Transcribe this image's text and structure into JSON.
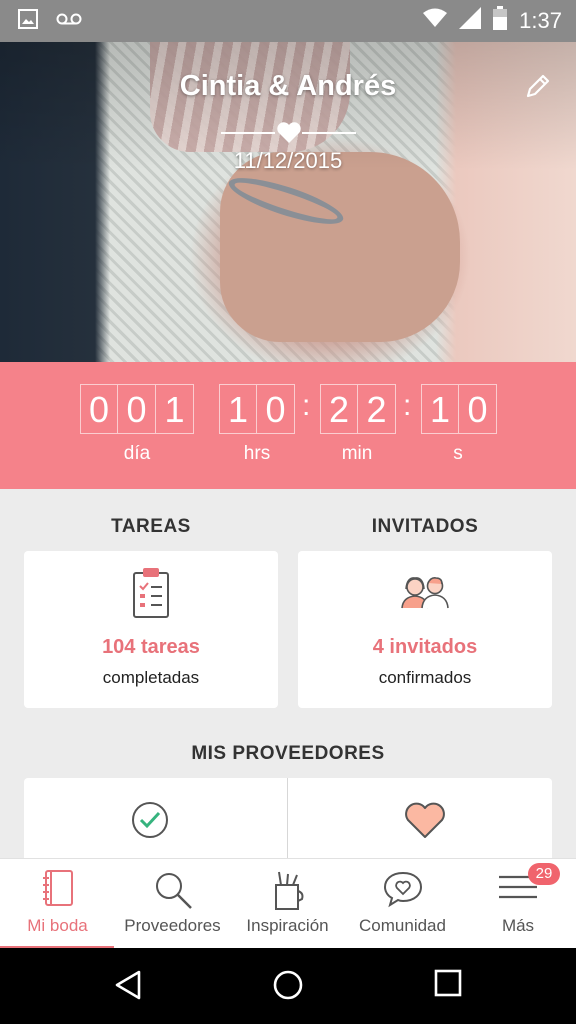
{
  "status_bar": {
    "time": "1:37",
    "icons": [
      "image-icon",
      "voicemail-icon",
      "wifi-icon",
      "signal-icon",
      "battery-icon"
    ]
  },
  "hero": {
    "couple_names": "Cintia & Andrés",
    "date": "11/12/2015"
  },
  "countdown": {
    "days": [
      "0",
      "0",
      "1"
    ],
    "hours": [
      "1",
      "0"
    ],
    "minutes": [
      "2",
      "2"
    ],
    "seconds": [
      "1",
      "0"
    ],
    "labels": {
      "days": "día",
      "hours": "hrs",
      "minutes": "min",
      "seconds": "s"
    }
  },
  "tasks": {
    "title": "TAREAS",
    "count": "104 tareas",
    "sub": "completadas"
  },
  "guests": {
    "title": "INVITADOS",
    "count": "4 invitados",
    "sub": "confirmados"
  },
  "providers": {
    "title": "MIS PROVEEDORES"
  },
  "bottom_nav": {
    "items": [
      {
        "label": "Mi boda",
        "icon": "notebook-icon"
      },
      {
        "label": "Proveedores",
        "icon": "search-icon"
      },
      {
        "label": "Inspiración",
        "icon": "inspiration-icon"
      },
      {
        "label": "Comunidad",
        "icon": "chat-heart-icon"
      },
      {
        "label": "Más",
        "icon": "menu-icon"
      }
    ],
    "badge": "29"
  },
  "colors": {
    "accent": "#f5828a",
    "accent_text": "#e8727a"
  }
}
